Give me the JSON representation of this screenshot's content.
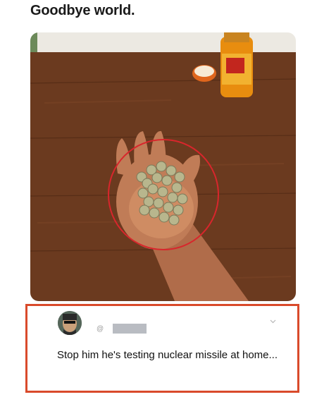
{
  "post": {
    "title": "Goodbye world."
  },
  "reply": {
    "handle_prefix": "@",
    "text": "Stop him he's testing nuclear missile at home...",
    "icons": [
      "avatar-image",
      "chevron-down-icon"
    ]
  },
  "colors": {
    "highlight_border": "#d94a2b",
    "circle_annotation": "#d8262c"
  }
}
